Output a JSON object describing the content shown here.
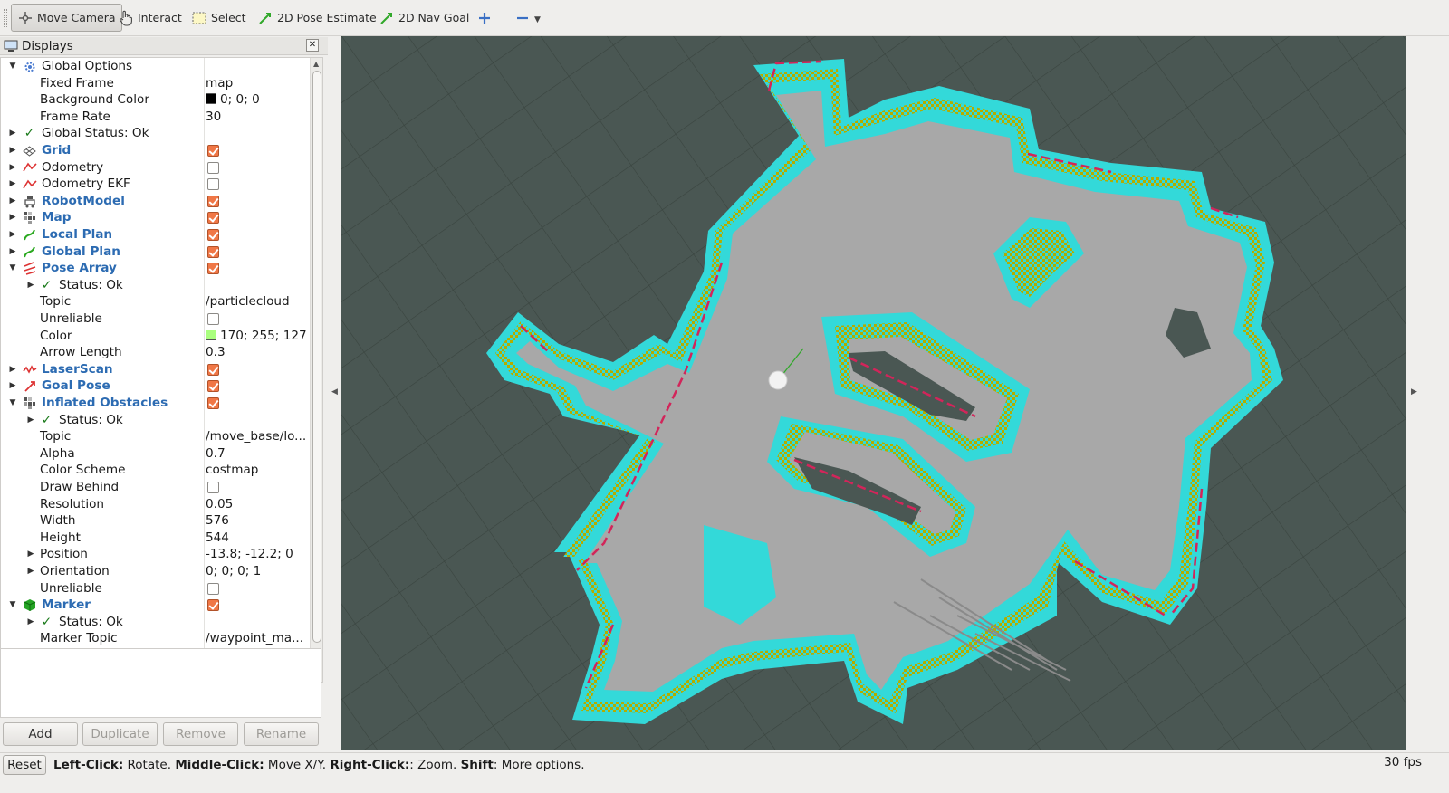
{
  "toolbar": {
    "move_camera": "Move Camera",
    "interact": "Interact",
    "select": "Select",
    "pose_estimate": "2D Pose Estimate",
    "nav_goal": "2D Nav Goal"
  },
  "displays": {
    "title": "Displays",
    "rows": {
      "global_options": "Global Options",
      "fixed_frame": "Fixed Frame",
      "fixed_frame_val": "map",
      "bg_color": "Background Color",
      "bg_color_val": "0; 0; 0",
      "frame_rate": "Frame Rate",
      "frame_rate_val": "30",
      "global_status": "Global Status: Ok",
      "grid": "Grid",
      "odometry": "Odometry",
      "odometry_ekf": "Odometry EKF",
      "robot_model": "RobotModel",
      "map": "Map",
      "local_plan": "Local Plan",
      "global_plan": "Global Plan",
      "pose_array": "Pose Array",
      "status_ok": "Status: Ok",
      "topic": "Topic",
      "pose_topic_val": "/particlecloud",
      "unreliable": "Unreliable",
      "color": "Color",
      "color_val": "170; 255; 127",
      "arrow_length": "Arrow Length",
      "arrow_length_val": "0.3",
      "laser_scan": "LaserScan",
      "goal_pose": "Goal Pose",
      "inflated": "Inflated Obstacles",
      "infl_topic_val": "/move_base/lo...",
      "alpha": "Alpha",
      "alpha_val": "0.7",
      "color_scheme": "Color Scheme",
      "color_scheme_val": "costmap",
      "draw_behind": "Draw Behind",
      "resolution": "Resolution",
      "resolution_val": "0.05",
      "width": "Width",
      "width_val": "576",
      "height": "Height",
      "height_val": "544",
      "position": "Position",
      "position_val": "-13.8; -12.2; 0",
      "orientation": "Orientation",
      "orientation_val": "0; 0; 0; 1",
      "marker": "Marker",
      "marker_topic": "Marker Topic",
      "marker_topic_val": "/waypoint_ma..."
    },
    "colors": {
      "bg_swatch": "#000000",
      "pose_swatch": "#aaff7f",
      "checked": "#f07746"
    }
  },
  "buttons": {
    "add": "Add",
    "duplicate": "Duplicate",
    "remove": "Remove",
    "rename": "Rename"
  },
  "status": {
    "reset": "Reset",
    "k1": "Left-Click:",
    "v1": " Rotate. ",
    "k2": "Middle-Click:",
    "v2": " Move X/Y. ",
    "k3": "Right-Click:",
    "v3": ": Zoom. ",
    "k4": "Shift",
    "v4": ": More options.",
    "fps": "30 fps"
  },
  "viewport": {
    "background": "#4a5753",
    "free_space": "#a7a7a7",
    "inflation": "#33d9d9",
    "lethal": "#b3ad00",
    "obstacle_edge": "#d2255a"
  }
}
